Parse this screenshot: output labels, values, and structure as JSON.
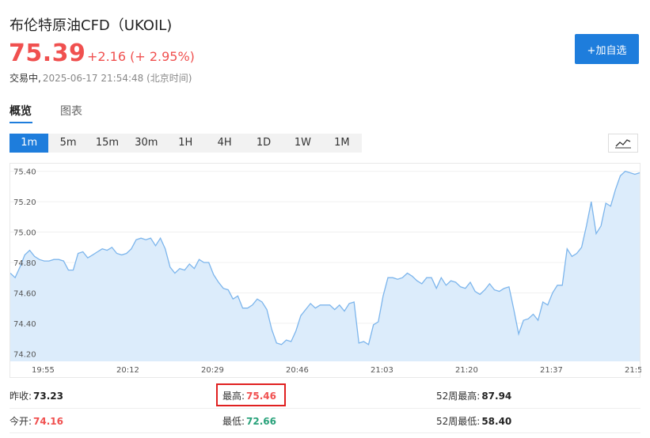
{
  "header": {
    "title": "布伦特原油CFD（UKOIL)",
    "price": "75.39",
    "change": "+2.16 (+ 2.95%)",
    "status": "交易中,",
    "timestamp": "2025-06-17 21:54:48 (北京时间)"
  },
  "watch_button": {
    "label": "+加自选"
  },
  "tabs": [
    {
      "label": "概览",
      "active": true
    },
    {
      "label": "图表",
      "active": false
    }
  ],
  "periods": [
    {
      "label": "1m",
      "active": true
    },
    {
      "label": "5m"
    },
    {
      "label": "15m"
    },
    {
      "label": "30m"
    },
    {
      "label": "1H"
    },
    {
      "label": "4H"
    },
    {
      "label": "1D"
    },
    {
      "label": "1W"
    },
    {
      "label": "1M"
    }
  ],
  "chart_type_icon": "line-chart-icon",
  "colors": {
    "up": "#f0504f",
    "down": "#2aa27b",
    "accent": "#1e7ddc",
    "line": "#7cb5ec",
    "area": "#dcecfb"
  },
  "chart_data": {
    "type": "area",
    "ylim": [
      74.15,
      75.45
    ],
    "yticks": [
      "75.40",
      "75.20",
      "75.00",
      "74.80",
      "74.60",
      "74.40",
      "74.20"
    ],
    "xticks": [
      "19:55",
      "20:12",
      "20:29",
      "20:46",
      "21:03",
      "21:20",
      "21:37",
      "21:5"
    ],
    "values": [
      74.73,
      74.7,
      74.77,
      74.85,
      74.88,
      74.84,
      74.82,
      74.81,
      74.81,
      74.82,
      74.82,
      74.81,
      74.75,
      74.75,
      74.86,
      74.87,
      74.83,
      74.85,
      74.87,
      74.89,
      74.88,
      74.9,
      74.86,
      74.85,
      74.86,
      74.89,
      74.95,
      74.96,
      74.95,
      74.96,
      74.91,
      74.96,
      74.89,
      74.77,
      74.73,
      74.76,
      74.75,
      74.79,
      74.76,
      74.82,
      74.8,
      74.8,
      74.72,
      74.67,
      74.63,
      74.62,
      74.56,
      74.58,
      74.5,
      74.5,
      74.52,
      74.56,
      74.54,
      74.49,
      74.36,
      74.27,
      74.26,
      74.29,
      74.28,
      74.35,
      74.45,
      74.49,
      74.53,
      74.5,
      74.52,
      74.52,
      74.52,
      74.49,
      74.52,
      74.48,
      74.53,
      74.54,
      74.27,
      74.28,
      74.26,
      74.39,
      74.41,
      74.58,
      74.7,
      74.7,
      74.69,
      74.7,
      74.73,
      74.71,
      74.68,
      74.66,
      74.7,
      74.7,
      74.63,
      74.7,
      74.65,
      74.68,
      74.67,
      74.64,
      74.63,
      74.67,
      74.61,
      74.59,
      74.62,
      74.66,
      74.62,
      74.61,
      74.63,
      74.64,
      74.49,
      74.33,
      74.42,
      74.43,
      74.46,
      74.42,
      74.54,
      74.52,
      74.6,
      74.65,
      74.65,
      74.89,
      74.84,
      74.86,
      74.9,
      75.04,
      75.2,
      74.99,
      75.04,
      75.19,
      75.17,
      75.28,
      75.37,
      75.4,
      75.39,
      75.38,
      75.39
    ]
  },
  "stats": {
    "prev_close": {
      "label": "昨收:",
      "value": "73.23"
    },
    "high": {
      "label": "最高:",
      "value": "75.46"
    },
    "high_52w": {
      "label": "52周最高:",
      "value": "87.94"
    },
    "open": {
      "label": "今开:",
      "value": "74.16"
    },
    "low": {
      "label": "最低:",
      "value": "72.66"
    },
    "low_52w": {
      "label": "52周最低:",
      "value": "58.40"
    }
  }
}
